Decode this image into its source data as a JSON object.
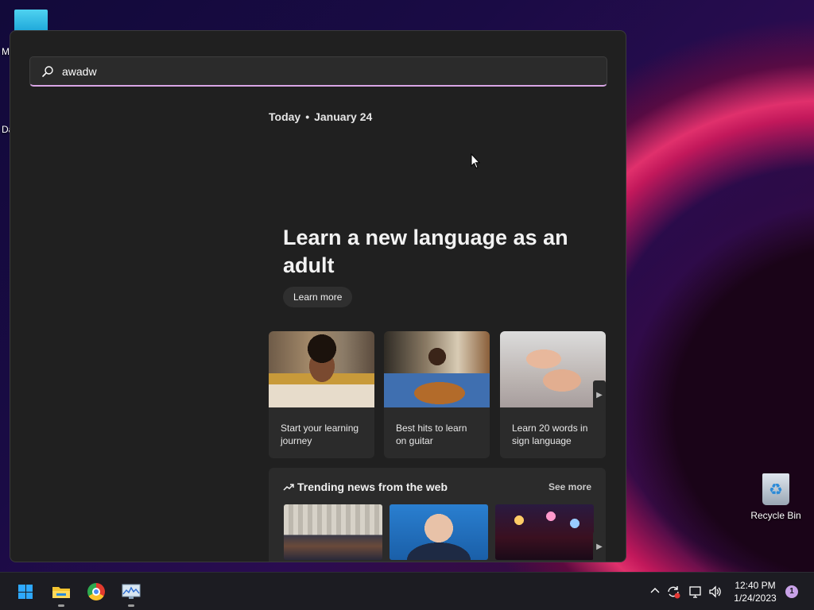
{
  "desktop": {
    "edge_labels": [
      "M",
      "Da"
    ],
    "recycle_bin_label": "Recycle Bin"
  },
  "start_panel": {
    "search": {
      "value": "awadw",
      "placeholder": ""
    },
    "date": {
      "prefix": "Today",
      "separator": "•",
      "date": "January 24"
    },
    "hero": {
      "title": "Learn a new language as an adult",
      "button": "Learn more"
    },
    "cards": [
      {
        "caption": "Start your learning journey",
        "image": "artist-woman"
      },
      {
        "caption": "Best hits to learn on guitar",
        "image": "guitar-player"
      },
      {
        "caption": "Learn 20 words in sign language",
        "image": "sign-hands"
      }
    ],
    "trending": {
      "title": "Trending news from the web",
      "see_more": "See more",
      "icon": "trending-arrow-icon"
    }
  },
  "taskbar": {
    "apps": [
      "start-icon",
      "file-explorer-icon",
      "chrome-icon",
      "resource-monitor-icon"
    ],
    "clock": {
      "time": "12:40 PM",
      "date": "1/24/2023"
    },
    "notification_count": "1"
  },
  "colors": {
    "accent_underline": "#d9a6e6",
    "panel_bg": "#202020",
    "card_bg": "#2b2b2b",
    "taskbar_bg": "#1c1c22",
    "windows_blue": "#2ea8ff"
  }
}
